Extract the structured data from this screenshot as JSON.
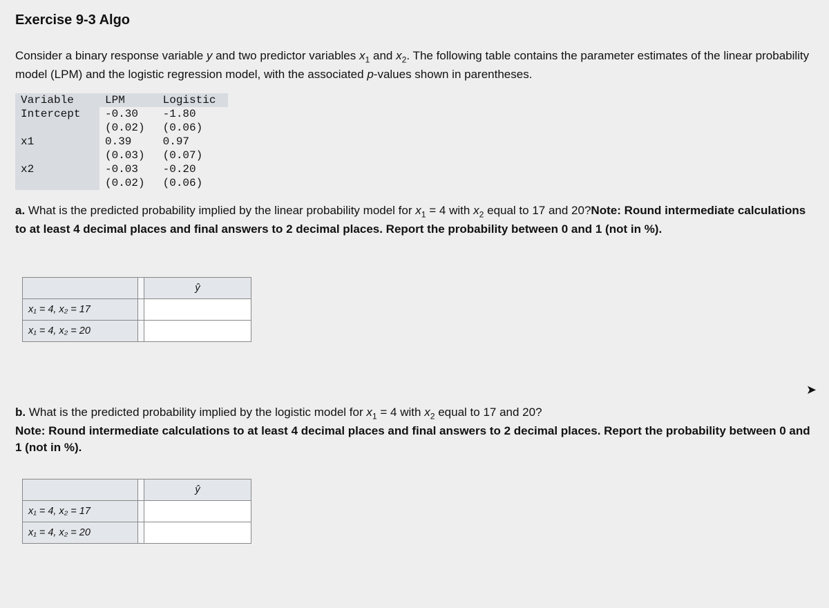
{
  "title": "Exercise 9-3 Algo",
  "intro_parts": {
    "p1": "Consider a binary response variable ",
    "y": "y",
    "p2": " and two predictor variables ",
    "x1": "x",
    "x1sub": "1",
    "p3": " and ",
    "x2": "x",
    "x2sub": "2",
    "p4": ". The following table contains the parameter estimates of the linear probability model (LPM) and the logistic regression model, with the associated ",
    "pval": "p",
    "p5": "-values shown in parentheses."
  },
  "param_table": {
    "headers": {
      "c0": "Variable",
      "c1": "LPM",
      "c2": "Logistic"
    },
    "rows": [
      {
        "label": "Intercept",
        "lpm_est": "-0.30",
        "lpm_p": "(0.02)",
        "log_est": "-1.80",
        "log_p": "(0.06)"
      },
      {
        "label": "x1",
        "lpm_est": "0.39",
        "lpm_p": "(0.03)",
        "log_est": "0.97",
        "log_p": "(0.07)"
      },
      {
        "label": "x2",
        "lpm_est": "-0.03",
        "lpm_p": "(0.02)",
        "log_est": "-0.20",
        "log_p": "(0.06)"
      }
    ]
  },
  "part_a": {
    "lead": "a. ",
    "q1": "What is the predicted probability implied by the linear probability model for ",
    "x1": "x",
    "x1sub": "1",
    "q2": " = 4 with ",
    "x2": "x",
    "x2sub": "2",
    "q3": " equal to 17 and 20?",
    "note": "Note: Round intermediate calculations to at least 4 decimal places and final answers to 2 decimal places. Report the probability between 0 and 1 (not in %)."
  },
  "answer_a": {
    "yhat": "ŷ",
    "row1": "x₁ = 4, x₂ = 17",
    "row2": "x₁ = 4, x₂ = 20"
  },
  "part_b": {
    "lead": "b. ",
    "q1": "What is the predicted probability implied by the logistic model for ",
    "x1": "x",
    "x1sub": "1",
    "q2": " = 4 with ",
    "x2": "x",
    "x2sub": "2",
    "q3": " equal to 17 and 20?",
    "note": "Note: Round intermediate calculations to at least 4 decimal places and final answers to 2 decimal places. Report the probability between 0 and 1 (not in %)."
  },
  "answer_b": {
    "yhat": "ŷ",
    "row1": "x₁ = 4, x₂ = 17",
    "row2": "x₁ = 4, x₂ = 20"
  }
}
